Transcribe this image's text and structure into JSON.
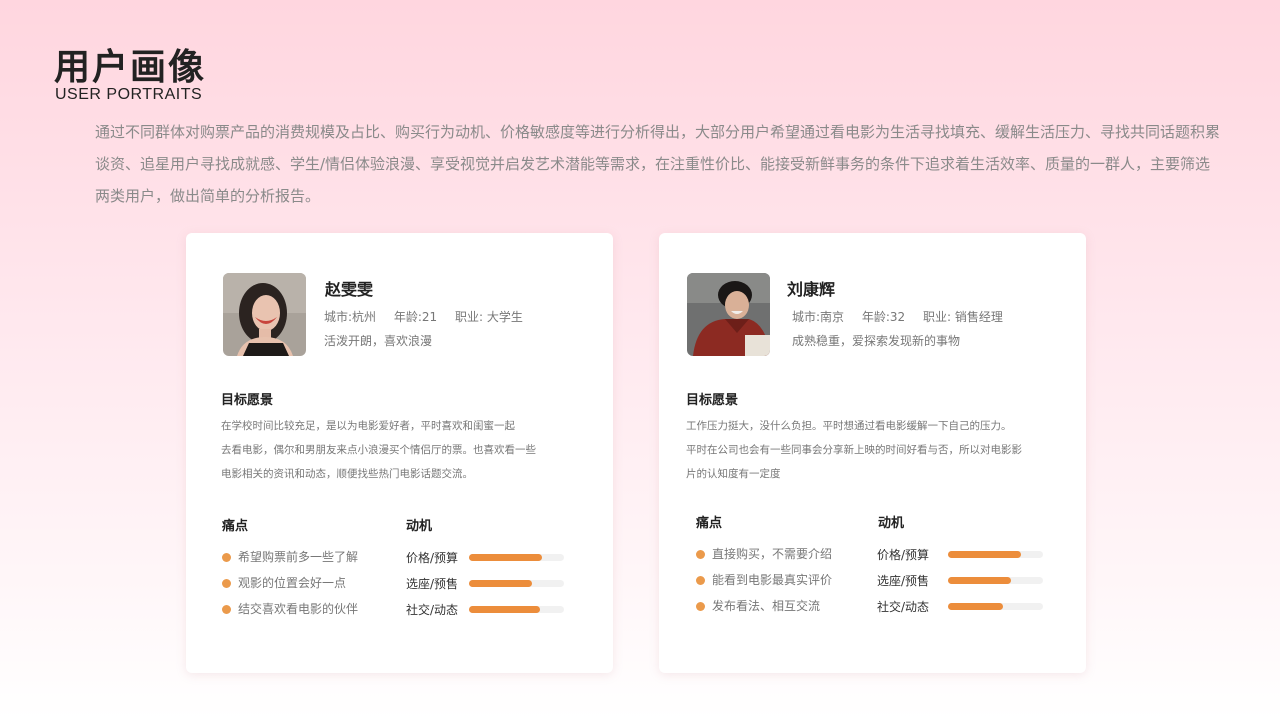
{
  "page": {
    "title": "用户画像",
    "subtitle": "USER PORTRAITS",
    "intro": "通过不同群体对购票产品的消费规模及占比、购买行为动机、价格敏感度等进行分析得出，大部分用户希望通过看电影为生活寻找填充、缓解生活压力、寻找共同话题积累谈资、追星用户寻找成就感、学生/情侣体验浪漫、享受视觉并启发艺术潜能等需求，在注重性价比、能接受新鲜事务的条件下追求着生活效率、质量的一群人，主要筛选两类用户，做出简单的分析报告。"
  },
  "colors": {
    "accent": "#ec8d3b",
    "dot": "#eb9a4b",
    "track": "#f1f1f1"
  },
  "users": [
    {
      "name": "赵雯雯",
      "city": "城市:杭州",
      "age": "年龄:21",
      "job": "职业: 大学生",
      "tagline": "活泼开朗，喜欢浪漫",
      "goal_title": "目标愿景",
      "goal_lines": [
        "在学校时间比较充足，是以为电影爱好者，平时喜欢和闺蜜一起",
        "去看电影，偶尔和男朋友来点小浪漫买个情侣厅的票。也喜欢看一些",
        "电影相关的资讯和动态，顺便找些热门电影话题交流。"
      ],
      "pain_title": "痛点",
      "pains": [
        "希望购票前多一些了解",
        "观影的位置会好一点",
        "结交喜欢看电影的伙伴"
      ],
      "motive_title": "动机",
      "motives": [
        {
          "label": "价格/预算",
          "value": 0.77
        },
        {
          "label": "选座/预售",
          "value": 0.66
        },
        {
          "label": "社交/动态",
          "value": 0.75
        }
      ]
    },
    {
      "name": "刘康辉",
      "city": "城市:南京",
      "age": "年龄:32",
      "job": "职业: 销售经理",
      "tagline": "成熟稳重，爱探索发现新的事物",
      "goal_title": "目标愿景",
      "goal_lines": [
        "工作压力挺大，没什么负担。平时想通过看电影缓解一下自己的压力。",
        "平时在公司也会有一些同事会分享新上映的时间好看与否，所以对电影影",
        "片的认知度有一定度"
      ],
      "pain_title": "痛点",
      "pains": [
        "直接购买，不需要介绍",
        "能看到电影最真实评价",
        "发布看法、相互交流"
      ],
      "motive_title": "动机",
      "motives": [
        {
          "label": "价格/预算",
          "value": 0.77
        },
        {
          "label": "选座/预售",
          "value": 0.66
        },
        {
          "label": "社交/动态",
          "value": 0.58
        }
      ]
    }
  ]
}
